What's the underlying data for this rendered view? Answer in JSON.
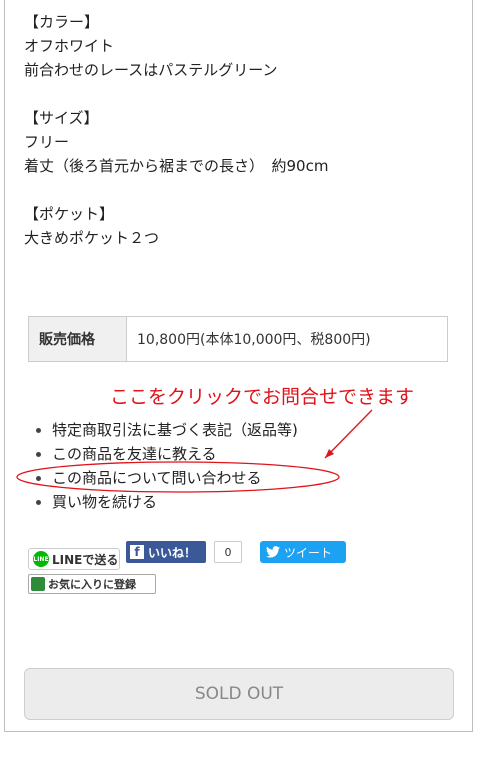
{
  "description": {
    "lines": [
      "【カラー】",
      "オフホワイト",
      "前合わせのレースはパステルグリーン",
      "",
      "【サイズ】",
      "フリー",
      "着丈（後ろ首元から裾までの長さ）　約90cm",
      "",
      "【ポケット】",
      "大きめポケット２つ"
    ]
  },
  "price": {
    "label": "販売価格",
    "value": "10,800円(本体10,000円、税800円)"
  },
  "annotation": {
    "text": "ここをクリックでお問合せできます",
    "color": "#e0121a"
  },
  "links": [
    "特定商取引法に基づく表記（返品等)",
    "この商品を友達に教える",
    "この商品について問い合わせる",
    "買い物を続ける"
  ],
  "social": {
    "line_label": "LINEで送る",
    "line_logo": "LINE",
    "fb_label": "いいね！",
    "fb_count": "0",
    "tweet_label": "ツイート",
    "favorite_label": "お気に入りに登録"
  },
  "sold_out_label": "SOLD OUT"
}
